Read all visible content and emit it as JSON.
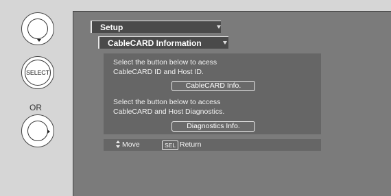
{
  "remote": {
    "select_label": "SELECT",
    "or_label": "OR"
  },
  "menu": {
    "level1": "Setup",
    "level2": "CableCARD Information"
  },
  "panel": {
    "text1_line1": "Select the button below to acess",
    "text1_line2": "CableCARD ID and Host ID.",
    "button1_label": "CableCARD Info.",
    "text2_line1": "Select the button below to access",
    "text2_line2": "CableCARD and Host Diagnostics.",
    "button2_label": "Diagnostics Info."
  },
  "footer": {
    "move_label": "Move",
    "sel_key": "SEL",
    "return_label": "Return"
  },
  "colors": {
    "screen_bg": "#7b7b7b",
    "panel_bg": "#666666",
    "menu_bg": "#4a4a4a",
    "page_bg": "#d6d6d6"
  }
}
